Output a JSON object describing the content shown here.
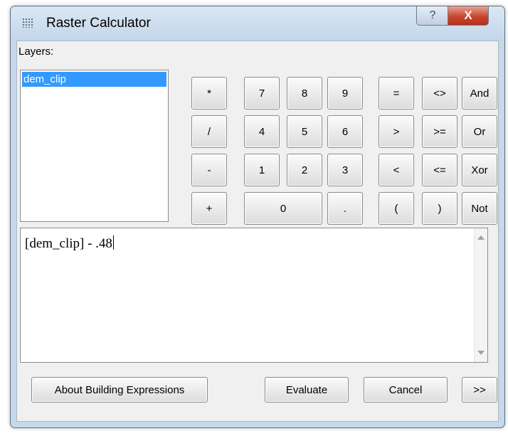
{
  "window": {
    "title": "Raster Calculator",
    "help_label": "?",
    "close_label": "X"
  },
  "layers": {
    "label": "Layers:",
    "items": [
      "dem_clip"
    ],
    "selected": "dem_clip"
  },
  "operators": {
    "multiply": "*",
    "divide": "/",
    "subtract": "-",
    "add": "+",
    "equal": "=",
    "not_equal": "<>",
    "greater": ">",
    "greater_equal": ">=",
    "less": "<",
    "less_equal": "<=",
    "open_paren": "(",
    "close_paren": ")",
    "and": "And",
    "or": "Or",
    "xor": "Xor",
    "not": "Not",
    "decimal": "."
  },
  "digits": [
    "0",
    "1",
    "2",
    "3",
    "4",
    "5",
    "6",
    "7",
    "8",
    "9"
  ],
  "expression": "[dem_clip] - .48",
  "footer": {
    "about": "About Building Expressions",
    "evaluate": "Evaluate",
    "cancel": "Cancel",
    "more": ">>"
  }
}
